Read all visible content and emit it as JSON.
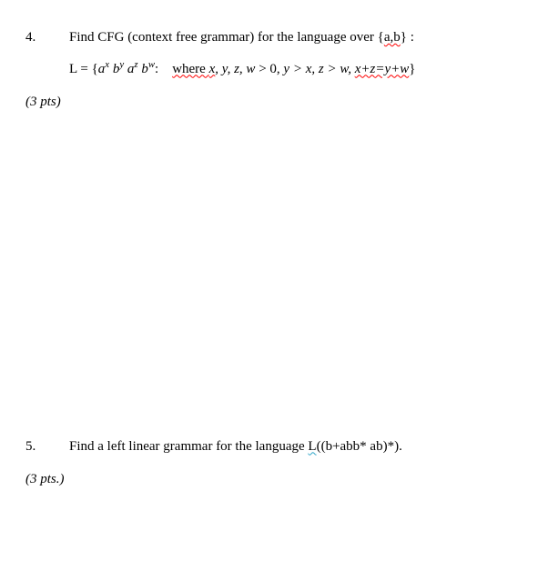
{
  "q4": {
    "num": "4.",
    "prompt_a": "Find CFG (context free grammar) for the language over {",
    "prompt_ab": "a,b",
    "prompt_b": "} :",
    "formula_L": "L = {",
    "a": "a",
    "x": "x",
    "b": "b",
    "y": "y",
    "z": "z",
    "w": "w",
    "colon": ":",
    "where": "where ",
    "where_x": "x",
    "cond_rest": ", y, z, w",
    "gt0": " > 0,  ",
    "yx": "y > x,  z > w,  ",
    "xtz": "x+z=y+w",
    "close": "}",
    "points": "(3 pts)"
  },
  "q5": {
    "num": "5.",
    "prompt_a": "Find a left linear grammar for the language ",
    "L": "L",
    "expr": "((b+abb* ab)*).",
    "points": "(3 pts.)"
  }
}
